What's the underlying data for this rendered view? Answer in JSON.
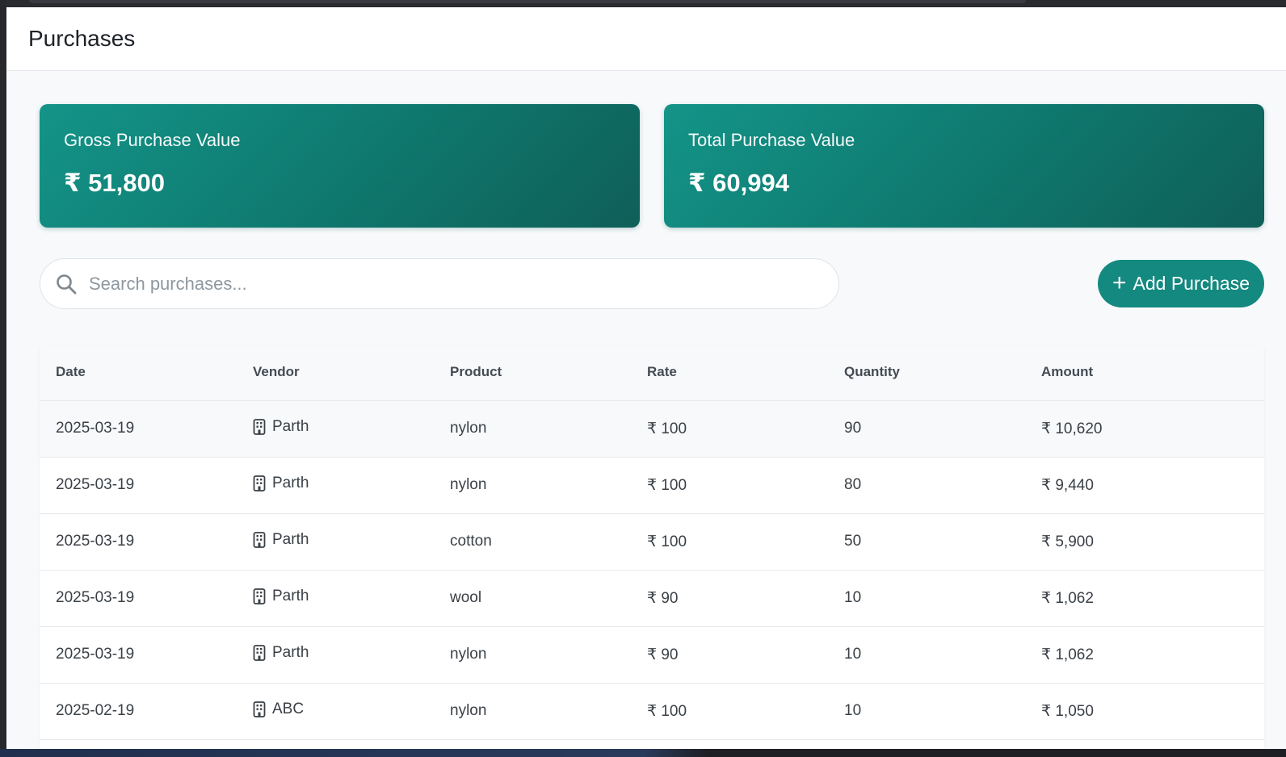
{
  "page": {
    "title": "Purchases"
  },
  "cards": [
    {
      "label": "Gross Purchase Value",
      "value": "₹ 51,800"
    },
    {
      "label": "Total Purchase Value",
      "value": "₹ 60,994"
    }
  ],
  "search": {
    "placeholder": "Search purchases...",
    "value": ""
  },
  "actions": {
    "add_purchase_label": "Add Purchase",
    "add_icon": "+"
  },
  "table": {
    "columns": [
      "Date",
      "Vendor",
      "Product",
      "Rate",
      "Quantity",
      "Amount"
    ],
    "rows": [
      {
        "date": "2025-03-19",
        "vendor": "Parth",
        "product": "nylon",
        "rate": "₹ 100",
        "quantity": "90",
        "amount": "₹ 10,620"
      },
      {
        "date": "2025-03-19",
        "vendor": "Parth",
        "product": "nylon",
        "rate": "₹ 100",
        "quantity": "80",
        "amount": "₹ 9,440"
      },
      {
        "date": "2025-03-19",
        "vendor": "Parth",
        "product": "cotton",
        "rate": "₹ 100",
        "quantity": "50",
        "amount": "₹ 5,900"
      },
      {
        "date": "2025-03-19",
        "vendor": "Parth",
        "product": "wool",
        "rate": "₹ 90",
        "quantity": "10",
        "amount": "₹ 1,062"
      },
      {
        "date": "2025-03-19",
        "vendor": "Parth",
        "product": "nylon",
        "rate": "₹ 90",
        "quantity": "10",
        "amount": "₹ 1,062"
      },
      {
        "date": "2025-02-19",
        "vendor": "ABC",
        "product": "nylon",
        "rate": "₹ 100",
        "quantity": "10",
        "amount": "₹ 1,050"
      }
    ]
  },
  "icons": {
    "search": "search-icon",
    "vendor": "building-icon",
    "add": "plus-icon"
  },
  "colors": {
    "accent": "#14897f",
    "card_start": "#149488",
    "card_end": "#0f5f58"
  }
}
